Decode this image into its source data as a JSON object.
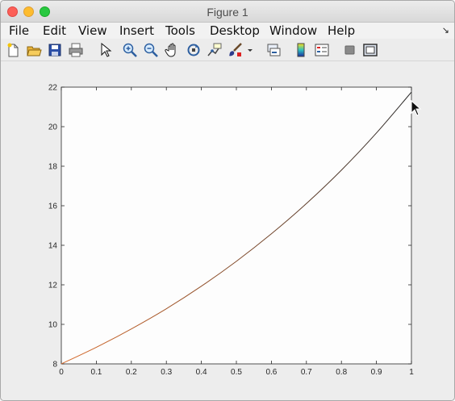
{
  "window": {
    "title": "Figure 1"
  },
  "menu": {
    "items": [
      "File",
      "Edit",
      "View",
      "Insert",
      "Tools",
      "Desktop",
      "Window",
      "Help"
    ],
    "corner_glyph": "↘"
  },
  "toolbar": {
    "buttons": [
      {
        "name": "new-figure-icon"
      },
      {
        "name": "open-file-icon"
      },
      {
        "name": "save-icon"
      },
      {
        "name": "print-icon"
      },
      {
        "name": "pointer-icon"
      },
      {
        "name": "zoom-in-icon"
      },
      {
        "name": "zoom-out-icon"
      },
      {
        "name": "pan-hand-icon"
      },
      {
        "name": "rotate-3d-icon"
      },
      {
        "name": "data-cursor-icon"
      },
      {
        "name": "brush-icon"
      },
      {
        "name": "brush-dropdown-icon"
      },
      {
        "name": "link-plot-icon"
      },
      {
        "name": "colorbar-icon"
      },
      {
        "name": "legend-icon"
      },
      {
        "name": "hide-plot-tools-icon"
      },
      {
        "name": "show-plot-tools-icon"
      }
    ]
  },
  "chart_data": {
    "type": "line",
    "title": "",
    "xlabel": "",
    "ylabel": "",
    "xlim": [
      0,
      1
    ],
    "ylim": [
      8,
      22
    ],
    "xticks": [
      0,
      0.1,
      0.2,
      0.3,
      0.4,
      0.5,
      0.6,
      0.7,
      0.8,
      0.9,
      1
    ],
    "xtick_labels": [
      "0",
      "0.1",
      "0.2",
      "0.3",
      "0.4",
      "0.5",
      "0.6",
      "0.7",
      "0.8",
      "0.9",
      "1"
    ],
    "yticks": [
      8,
      10,
      12,
      14,
      16,
      18,
      20,
      22
    ],
    "ytick_labels": [
      "8",
      "10",
      "12",
      "14",
      "16",
      "18",
      "20",
      "22"
    ],
    "grid": false,
    "series": [
      {
        "color_start": "#d96b2b",
        "color_end": "#2a2a2a",
        "x": [
          0,
          0.1,
          0.2,
          0.3,
          0.4,
          0.5,
          0.6,
          0.7,
          0.8,
          0.9,
          1
        ],
        "y": [
          8.0,
          8.84,
          9.77,
          10.79,
          11.93,
          13.19,
          14.58,
          16.11,
          17.8,
          19.68,
          21.75
        ]
      }
    ]
  }
}
